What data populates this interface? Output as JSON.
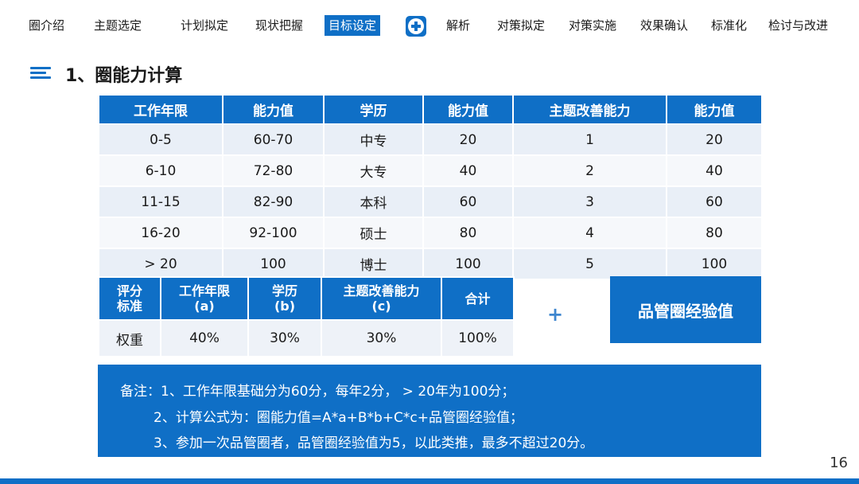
{
  "nav": {
    "items": [
      "圈介绍",
      "主题选定",
      "计划拟定",
      "现状把握",
      "目标设定",
      "解析",
      "对策拟定",
      "对策实施",
      "效果确认",
      "标准化",
      "检讨与改进"
    ],
    "active_index": 4,
    "plus_icon": "plus-circle-icon"
  },
  "section": {
    "title": "1、圈能力计算"
  },
  "ability_table": {
    "headers": [
      "工作年限",
      "能力值",
      "学历",
      "能力值",
      "主题改善能力",
      "能力值"
    ],
    "rows": [
      [
        "0-5",
        "60-70",
        "中专",
        "20",
        "1",
        "20"
      ],
      [
        "6-10",
        "72-80",
        "大专",
        "40",
        "2",
        "40"
      ],
      [
        "11-15",
        "82-90",
        "本科",
        "60",
        "3",
        "60"
      ],
      [
        "16-20",
        "92-100",
        "硕士",
        "80",
        "4",
        "80"
      ],
      [
        "> 20",
        "100",
        "博士",
        "100",
        "5",
        "100"
      ]
    ]
  },
  "weight_table": {
    "headers": [
      {
        "line1": "评分",
        "line2": "标准"
      },
      {
        "line1": "工作年限",
        "line2": "(a)"
      },
      {
        "line1": "学历",
        "line2": "(b)"
      },
      {
        "line1": "主题改善能力",
        "line2": "(c)"
      },
      {
        "line1": "合计",
        "line2": ""
      }
    ],
    "row": [
      "权重",
      "40%",
      "30%",
      "30%",
      "100%"
    ]
  },
  "plus_sign": "+",
  "experience_box": "品管圈经验值",
  "notes": [
    "备注：1、工作年限基础分为60分，每年2分， > 20年为100分；",
    "2、计算公式为：圈能力值=A*a+B*b+C*c+品管圈经验值；",
    "3、参加一次品管圈者，品管圈经验值为5，以此类推，最多不超过20分。"
  ],
  "page_number": "16",
  "colors": {
    "accent": "#0f6fc6",
    "row_light": "#e9eff7",
    "row_lighter": "#f6f8fb"
  }
}
